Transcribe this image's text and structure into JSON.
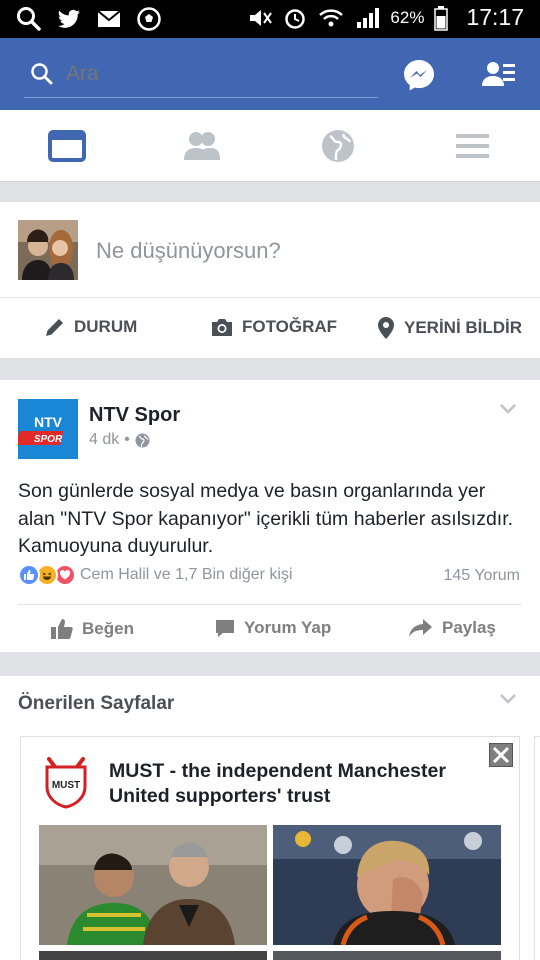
{
  "status_bar": {
    "battery_percent": "62%",
    "time": "17:17"
  },
  "header": {
    "search_placeholder": "Ara"
  },
  "composer": {
    "prompt": "Ne düşünüyorsun?",
    "actions": {
      "status": "DURUM",
      "photo": "FOTOĞRAF",
      "checkin": "YERİNİ BİLDİR"
    }
  },
  "post": {
    "page_name": "NTV Spor",
    "logo_top": "NTV",
    "logo_bottom": "SPOR",
    "time_ago": "4 dk",
    "separator": "•",
    "text": "Son günlerde sosyal medya ve basın organlarında yer alan \"NTV Spor kapanıyor\" içerikli tüm haberler asılsızdır. Kamuoyuna duyurulur.",
    "reactions_text": "Cem Halil ve 1,7 Bin diğer kişi",
    "comments_count": "145 Yorum",
    "actions": {
      "like": "Beğen",
      "comment": "Yorum Yap",
      "share": "Paylaş"
    }
  },
  "suggested": {
    "title": "Önerilen Sayfalar",
    "card": {
      "logo_text": "MUST",
      "title": "MUST - the independent Manchester United supporters' trust"
    }
  },
  "colors": {
    "brand": "#4267b2",
    "tab_active": "#4267b2",
    "tab_inactive": "#bec2c9"
  }
}
